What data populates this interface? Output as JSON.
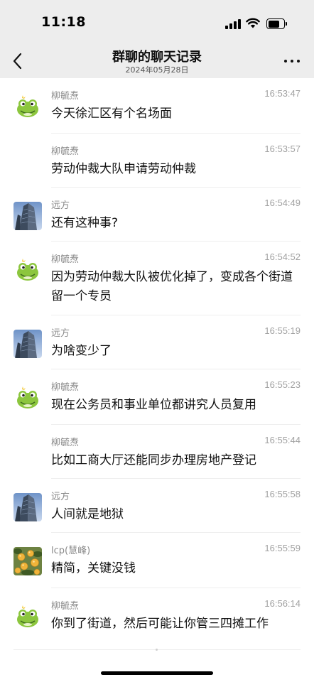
{
  "status_bar": {
    "time": "11:18"
  },
  "nav": {
    "title": "群聊的聊天记录",
    "date": "2024年05月28日",
    "back_icon": "chevron-left-icon",
    "more_icon": "more-dots-icon"
  },
  "messages": [
    {
      "sender": "柳毓焘",
      "time": "16:53:47",
      "text": "今天徐汇区有个名场面",
      "avatar": "frog"
    },
    {
      "sender": "柳毓焘",
      "time": "16:53:57",
      "text": "劳动仲裁大队申请劳动仲裁",
      "avatar": ""
    },
    {
      "sender": "远方",
      "time": "16:54:49",
      "text": "还有这种事?",
      "avatar": "building"
    },
    {
      "sender": "柳毓焘",
      "time": "16:54:52",
      "text": "因为劳动仲裁大队被优化掉了，变成各个街道留一个专员",
      "avatar": "frog"
    },
    {
      "sender": "远方",
      "time": "16:55:19",
      "text": "为啥变少了",
      "avatar": "building"
    },
    {
      "sender": "柳毓焘",
      "time": "16:55:23",
      "text": "现在公务员和事业单位都讲究人员复用",
      "avatar": "frog"
    },
    {
      "sender": "柳毓焘",
      "time": "16:55:44",
      "text": "比如工商大厅还能同步办理房地产登记",
      "avatar": ""
    },
    {
      "sender": "远方",
      "time": "16:55:58",
      "text": "人间就是地狱",
      "avatar": "building"
    },
    {
      "sender": "lcp(慧峰)",
      "time": "16:55:59",
      "text": "精简，关键没钱",
      "avatar": "oranges"
    },
    {
      "sender": "柳毓焘",
      "time": "16:56:14",
      "text": "你到了街道，然后可能让你管三四摊工作",
      "avatar": "frog"
    }
  ]
}
